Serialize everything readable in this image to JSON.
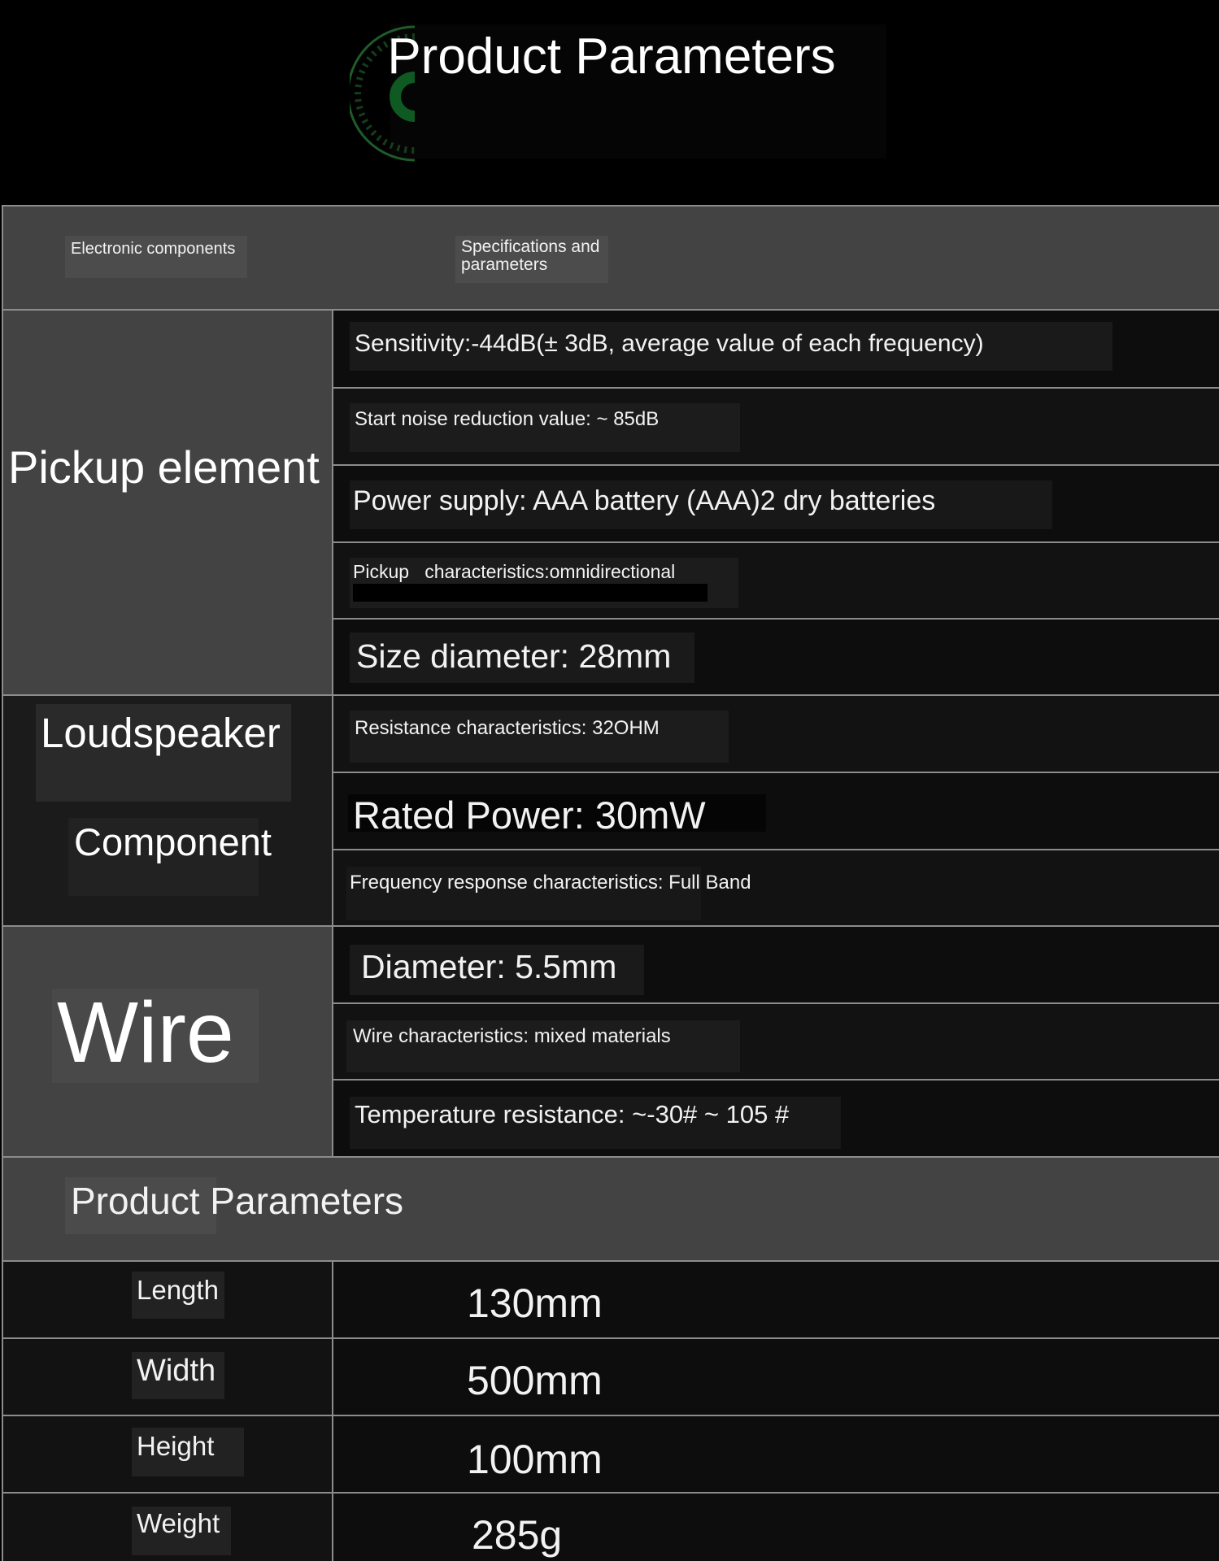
{
  "header": {
    "title": "Product Parameters"
  },
  "table": {
    "col_headers": [
      "Electronic components",
      "Specifications and",
      "parameters"
    ],
    "groups": [
      {
        "name": "Pickup element",
        "specs": [
          "Sensitivity:-44dB(± 3dB, average value of each frequency)",
          "Start noise reduction value: ~ 85dB",
          "Power supply: AAA battery (AAA)2 dry batteries",
          "Pickup   characteristics:omnidirectional",
          "Size diameter: 28mm"
        ]
      },
      {
        "name_line1": "Loudspeaker",
        "name_line2": "Component",
        "specs": [
          "Resistance characteristics: 32OHM",
          "Rated Power: 30mW",
          "Frequency response characteristics: Full Band"
        ]
      },
      {
        "name": "Wire",
        "specs": [
          "Diameter: 5.5mm",
          "Wire characteristics: mixed materials",
          "Temperature resistance: ~-30# ~ 105 #"
        ]
      }
    ]
  },
  "product_params": {
    "title": "Product Parameters",
    "rows": [
      {
        "label": "Length",
        "value": "130mm"
      },
      {
        "label": "Width",
        "value": "500mm"
      },
      {
        "label": "Height",
        "value": "100mm"
      },
      {
        "label": "Weight",
        "value": "285g"
      }
    ]
  },
  "colors": {
    "background": "#000000",
    "panel_grey": "#444344",
    "row_dark": "#0d0d0d",
    "grid_line": "#8c8c8c"
  }
}
